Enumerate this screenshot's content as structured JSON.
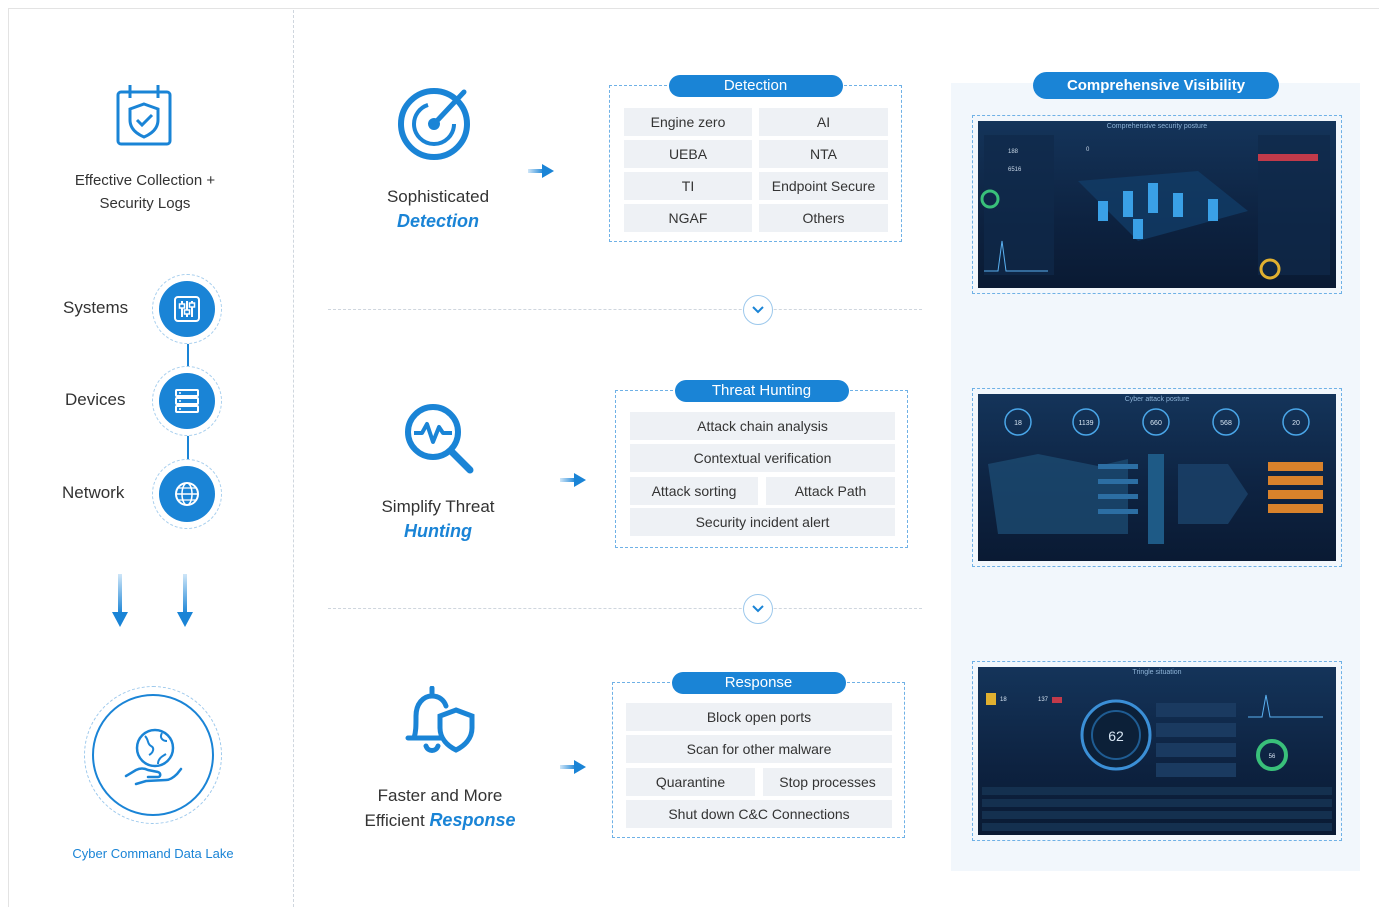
{
  "left": {
    "collection_title_line1": "Effective Collection +",
    "collection_title_line2": "Security Logs",
    "sources": [
      "Systems",
      "Devices",
      "Network"
    ],
    "data_lake_label": "Cyber Command Data Lake"
  },
  "stages": [
    {
      "title_line1": "Sophisticated",
      "title_emph": "Detection",
      "box_title": "Detection",
      "cells": [
        "Engine zero",
        "AI",
        "UEBA",
        "NTA",
        "TI",
        "Endpoint Secure",
        "NGAF",
        "Others"
      ]
    },
    {
      "title_line1": "Simplify Threat",
      "title_emph": "Hunting",
      "box_title": "Threat Hunting",
      "cells": [
        "Attack chain analysis",
        "Contextual verification",
        "Attack sorting",
        "Attack Path",
        "Security incident alert"
      ]
    },
    {
      "title_line1": "Faster and More",
      "title_prefix": "Efficient",
      "title_emph": "Response",
      "box_title": "Response",
      "cells": [
        "Block open ports",
        "Scan for other malware",
        "Quarantine",
        "Stop processes",
        "Shut down C&C Connections"
      ]
    }
  ],
  "visibility": {
    "title": "Comprehensive Visibility",
    "screens": [
      {
        "title": "Comprehensive security posture",
        "metrics": [
          "0",
          "188",
          "6516"
        ]
      },
      {
        "title": "Cyber attack posture",
        "metrics": [
          "18",
          "1139",
          "660",
          "568",
          "20"
        ]
      },
      {
        "title": "Tringle situation",
        "metrics": [
          "62",
          "18",
          "137",
          "56"
        ]
      }
    ]
  },
  "colors": {
    "accent": "#1a84d6",
    "panel": "#f2f7fc",
    "cell": "#eef1f5"
  }
}
